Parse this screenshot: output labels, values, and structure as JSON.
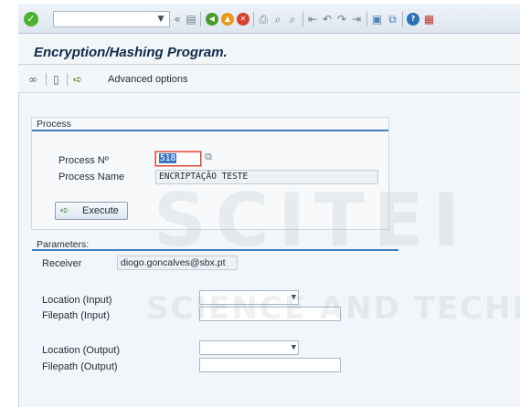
{
  "window": {
    "title": "Encryption/Hashing Program."
  },
  "system_toolbar": {
    "command_field_value": "",
    "icons": [
      "enter-icon",
      "back-icon",
      "exit-icon",
      "cancel-icon",
      "print-icon",
      "find-icon",
      "find-next-icon",
      "first-page-icon",
      "previous-page-icon",
      "next-page-icon",
      "last-page-icon",
      "new-session-icon",
      "shortcut-icon",
      "help-icon",
      "layout-icon"
    ]
  },
  "app_toolbar": {
    "advanced_options_label": "Advanced options"
  },
  "process": {
    "title": "Process",
    "process_no_label": "Process Nº",
    "process_no_value": "518",
    "process_name_label": "Process Name",
    "process_name_value": "ENCRIPTAÇÃO TESTE",
    "execute_label": "Execute"
  },
  "parameters": {
    "title": "Parameters:",
    "receiver_label": "Receiver",
    "receiver_value": "diogo.goncalves@sbx.pt",
    "location_input_label": "Location (Input)",
    "location_input_value": "",
    "filepath_input_label": "Filepath (Input)",
    "filepath_input_value": "",
    "location_output_label": "Location (Output)",
    "location_output_value": "",
    "filepath_output_label": "Filepath (Output)",
    "filepath_output_value": ""
  },
  "watermark": {
    "line1": "SCITEI",
    "line2": "SCIENCE AND TECHN"
  },
  "colors": {
    "ok_green": "#4caf2f",
    "group_line_blue": "#3f7fbf",
    "title_navy": "#0e2c4b",
    "focus_red": "#d84a3a"
  }
}
